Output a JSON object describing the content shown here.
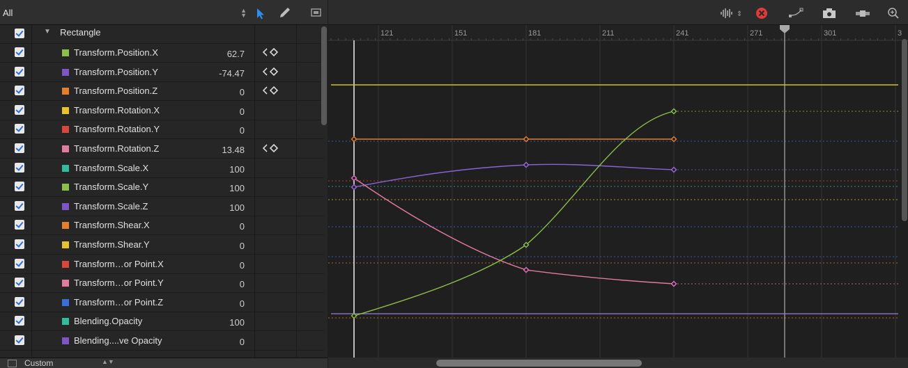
{
  "filter": {
    "label": "All"
  },
  "group": {
    "label": "Rectangle"
  },
  "parameters": [
    {
      "label": "Transform.Position.X",
      "value": "62.7",
      "color": "#8cc04a",
      "keyframe_nav": true
    },
    {
      "label": "Transform.Position.Y",
      "value": "-74.47",
      "color": "#7d55c7",
      "keyframe_nav": true
    },
    {
      "label": "Transform.Position.Z",
      "value": "0",
      "color": "#e57f2c",
      "keyframe_nav": true
    },
    {
      "label": "Transform.Rotation.X",
      "value": "0",
      "color": "#e8c22a",
      "keyframe_nav": false
    },
    {
      "label": "Transform.Rotation.Y",
      "value": "0",
      "color": "#d8463c",
      "keyframe_nav": false
    },
    {
      "label": "Transform.Rotation.Z",
      "value": "13.48",
      "color": "#e27ba0",
      "keyframe_nav": true
    },
    {
      "label": "Transform.Scale.X",
      "value": "100",
      "color": "#2fbd9c",
      "keyframe_nav": false
    },
    {
      "label": "Transform.Scale.Y",
      "value": "100",
      "color": "#8cc04a",
      "keyframe_nav": false
    },
    {
      "label": "Transform.Scale.Z",
      "value": "100",
      "color": "#7d55c7",
      "keyframe_nav": false
    },
    {
      "label": "Transform.Shear.X",
      "value": "0",
      "color": "#e57f2c",
      "keyframe_nav": false
    },
    {
      "label": "Transform.Shear.Y",
      "value": "0",
      "color": "#e8c22a",
      "keyframe_nav": false
    },
    {
      "label": "Transform…or Point.X",
      "value": "0",
      "color": "#d8463c",
      "keyframe_nav": false
    },
    {
      "label": "Transform…or Point.Y",
      "value": "0",
      "color": "#e27ba0",
      "keyframe_nav": false
    },
    {
      "label": "Transform…or Point.Z",
      "value": "0",
      "color": "#3b6fd8",
      "keyframe_nav": false
    },
    {
      "label": "Blending.Opacity",
      "value": "100",
      "color": "#2fbd9c",
      "keyframe_nav": false
    },
    {
      "label": "Blending....ve Opacity",
      "value": "0",
      "color": "#7d55c7",
      "keyframe_nav": false
    }
  ],
  "footer": {
    "label": "Custom"
  },
  "timeline": {
    "ticks": [
      "121",
      "151",
      "181",
      "211",
      "241",
      "271",
      "301",
      "3"
    ]
  },
  "icons": {
    "select_tool": "arrow-cursor-icon",
    "pen_tool": "pen-icon",
    "frame_tool": "frame-icon",
    "audio": "waveform-icon",
    "clear": "clear-curves-icon",
    "curve_tool": "curve-icon",
    "snapshot": "camera-icon",
    "fit": "fit-icon",
    "zoom": "zoom-icon"
  }
}
